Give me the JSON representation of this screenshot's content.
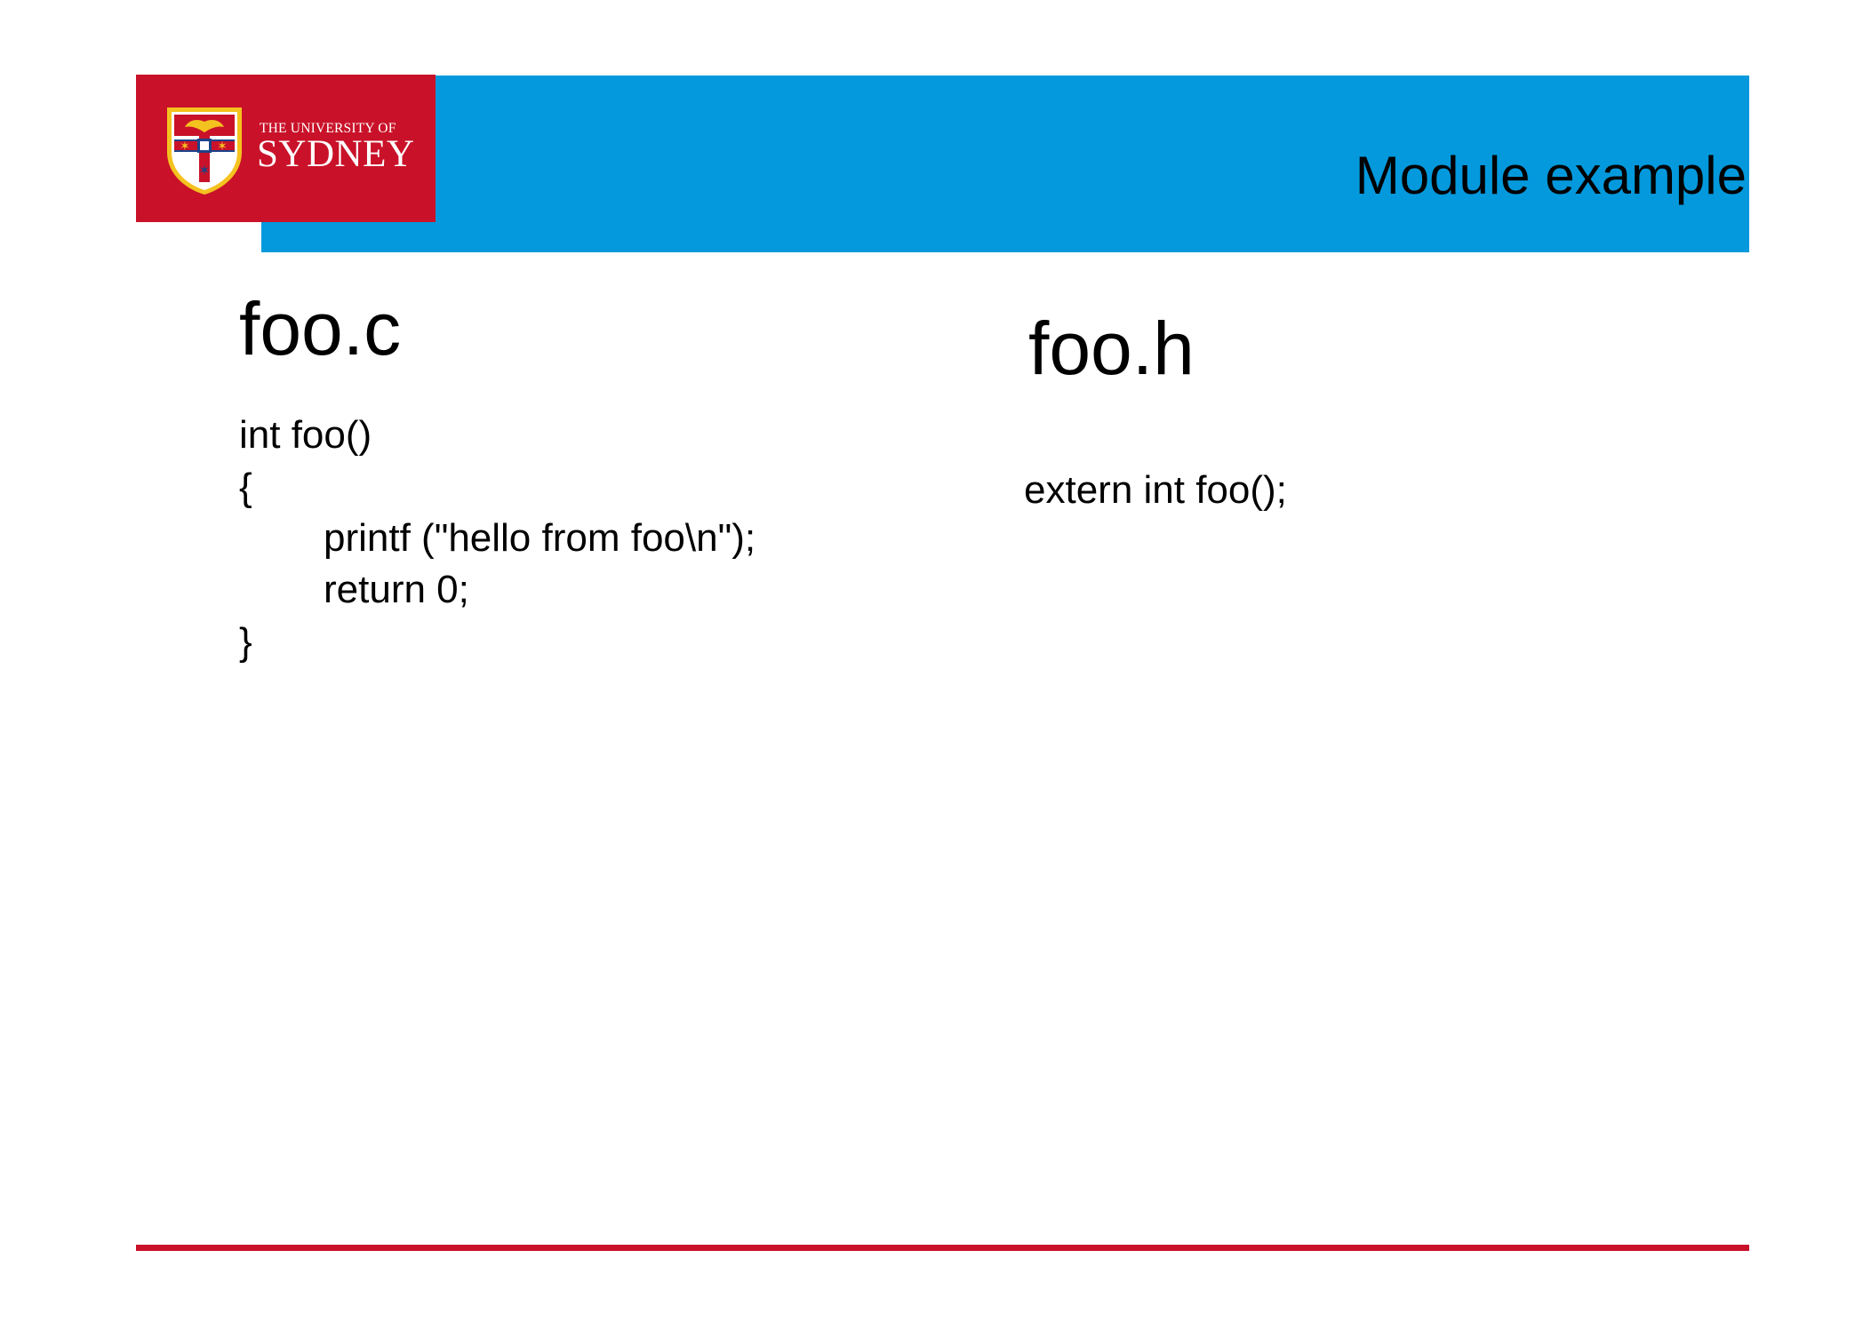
{
  "header": {
    "title": "Module example",
    "logo_line1": "THE UNIVERSITY OF",
    "logo_line2": "SYDNEY",
    "colors": {
      "bar": "#0399dc",
      "brand_red": "#c91229",
      "crest_gold": "#f4c21f"
    }
  },
  "left_column": {
    "heading": "foo.c",
    "code_lines": [
      "int foo()",
      "{",
      "printf (\"hello from foo\\n\");",
      "return 0;",
      "}"
    ]
  },
  "right_column": {
    "heading": "foo.h",
    "code_lines": [
      "extern int foo();"
    ]
  }
}
